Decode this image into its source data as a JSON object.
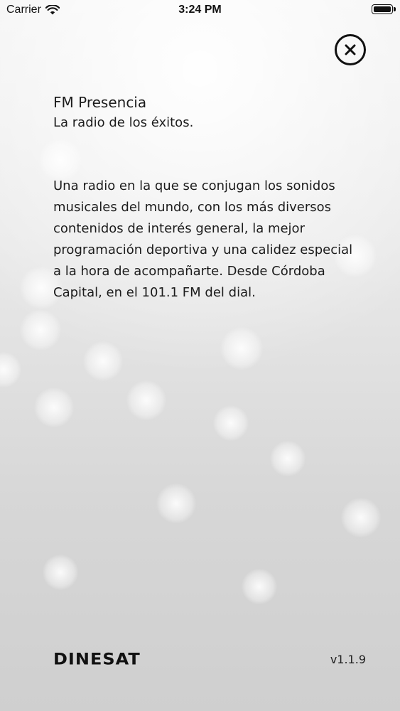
{
  "status_bar": {
    "carrier": "Carrier",
    "time": "3:24 PM",
    "wifi_icon": "wifi-icon",
    "battery_icon": "battery-icon"
  },
  "close_button": {
    "icon": "close-icon"
  },
  "station": {
    "name": "FM Presencia",
    "slogan": "La radio de los éxitos.",
    "description": "Una radio en la que se conjugan los sonidos musicales del mundo, con los más diversos contenidos de interés general, la mejor programación deportiva y una calidez especial a la hora de acompañarte. Desde Córdoba Capital, en el 101.1 FM del dial."
  },
  "footer": {
    "brand": "DINESAT",
    "version": "v1.1.9"
  }
}
